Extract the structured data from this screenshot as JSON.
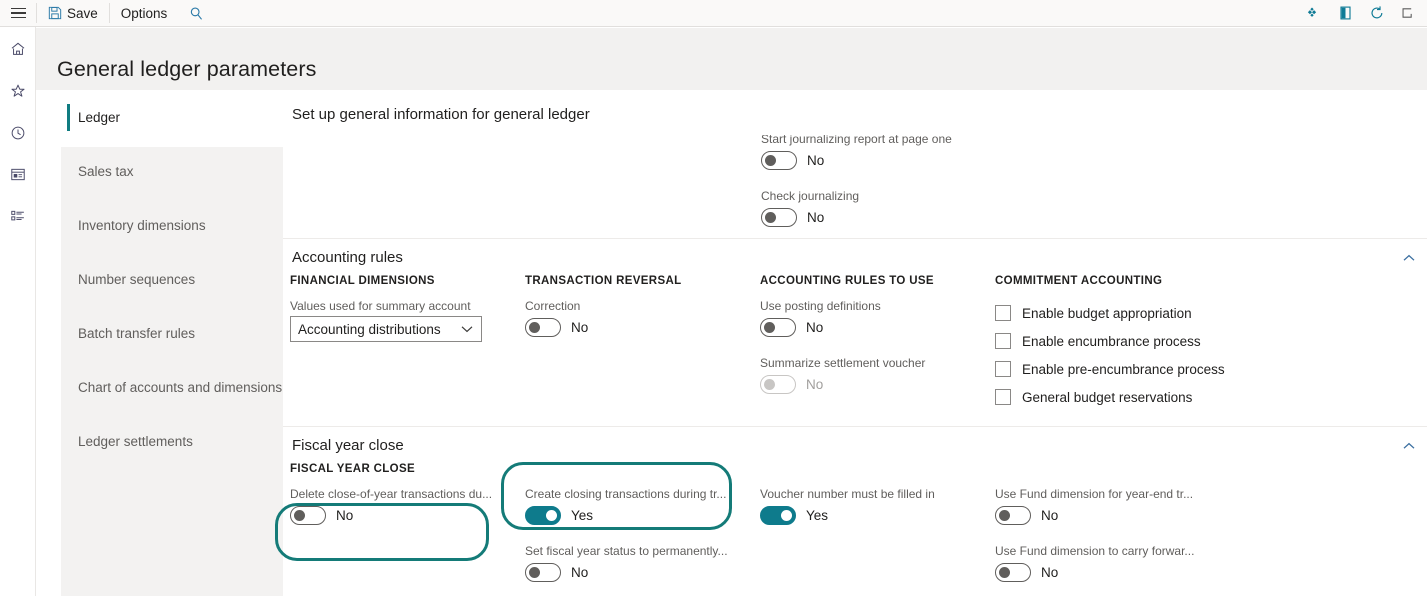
{
  "toolbar": {
    "menu_icon": "hamburger-icon",
    "save_label": "Save",
    "save_icon": "save-icon",
    "options_label": "Options",
    "search_icon": "search-icon",
    "right_icons": [
      {
        "name": "filter-icon"
      },
      {
        "name": "attachments-icon"
      },
      {
        "name": "refresh-icon"
      },
      {
        "name": "open-in-new-window-icon"
      }
    ]
  },
  "rail": {
    "items": [
      {
        "name": "home-icon",
        "label": "Home"
      },
      {
        "name": "favorites-star-icon",
        "label": "Favorites"
      },
      {
        "name": "recent-clock-icon",
        "label": "Recent"
      },
      {
        "name": "workspaces-icon",
        "label": "Workspaces"
      },
      {
        "name": "modules-list-icon",
        "label": "Modules"
      }
    ]
  },
  "page": {
    "title": "General ledger parameters"
  },
  "nav": {
    "items": [
      {
        "label": "Ledger",
        "selected": true
      },
      {
        "label": "Sales tax",
        "selected": false
      },
      {
        "label": "Inventory dimensions",
        "selected": false
      },
      {
        "label": "Number sequences",
        "selected": false
      },
      {
        "label": "Batch transfer rules",
        "selected": false
      },
      {
        "label": "Chart of accounts and dimensions",
        "selected": false
      },
      {
        "label": "Ledger settlements",
        "selected": false
      }
    ]
  },
  "main": {
    "heading": "Set up general information for general ledger",
    "clipped_fields": [
      {
        "label": "Start journalizing report at page one",
        "value": "No",
        "on": false
      },
      {
        "label": "Check journalizing",
        "value": "No",
        "on": false
      }
    ],
    "accounting_rules": {
      "title": "Accounting rules",
      "chevron": "chevron-up-icon",
      "groups": [
        {
          "heading": "FINANCIAL DIMENSIONS",
          "select": {
            "label": "Values used for summary account",
            "value": "Accounting distributions",
            "caret": "chevron-down-icon"
          }
        },
        {
          "heading": "TRANSACTION REVERSAL",
          "toggles": [
            {
              "label": "Correction",
              "value": "No",
              "on": false,
              "disabled": false
            }
          ]
        },
        {
          "heading": "ACCOUNTING RULES TO USE",
          "toggles": [
            {
              "label": "Use posting definitions",
              "value": "No",
              "on": false,
              "disabled": false
            },
            {
              "label": "Summarize settlement voucher",
              "value": "No",
              "on": false,
              "disabled": true
            }
          ]
        },
        {
          "heading": "COMMITMENT ACCOUNTING",
          "checkboxes": [
            {
              "label": "Enable budget appropriation",
              "checked": false
            },
            {
              "label": "Enable encumbrance process",
              "checked": false
            },
            {
              "label": "Enable pre-encumbrance process",
              "checked": false
            },
            {
              "label": "General budget reservations",
              "checked": false
            }
          ]
        }
      ]
    },
    "fiscal_year_close": {
      "title": "Fiscal year close",
      "chevron": "chevron-up-icon",
      "groups": [
        {
          "heading": "FISCAL YEAR CLOSE",
          "toggles": [
            {
              "label": "Delete close-of-year transactions du...",
              "value": "No",
              "on": false,
              "disabled": false
            }
          ]
        },
        {
          "heading": "",
          "toggles": [
            {
              "label": "Create closing transactions during tr...",
              "value": "Yes",
              "on": true,
              "disabled": false
            },
            {
              "label": "Set fiscal year status to permanently...",
              "value": "No",
              "on": false,
              "disabled": false
            }
          ]
        },
        {
          "heading": "",
          "toggles": [
            {
              "label": "Voucher number must be filled in",
              "value": "Yes",
              "on": true,
              "disabled": false
            }
          ]
        },
        {
          "heading": "",
          "toggles": [
            {
              "label": "Use Fund dimension for year-end tr...",
              "value": "No",
              "on": false,
              "disabled": false
            },
            {
              "label": "Use Fund dimension to carry forwar...",
              "value": "No",
              "on": false,
              "disabled": false
            }
          ]
        }
      ]
    }
  },
  "annotations": [
    {
      "name": "highlight-delete-close-of-year",
      "color": "#147b78"
    },
    {
      "name": "highlight-create-closing-transactions",
      "color": "#147b78"
    }
  ],
  "colors": {
    "accent_teal": "#107c81",
    "toggle_on": "#0e7b8c",
    "highlight": "#147b78",
    "band_gray": "#f2f1f0",
    "nav_gray": "#f3f2f1"
  }
}
